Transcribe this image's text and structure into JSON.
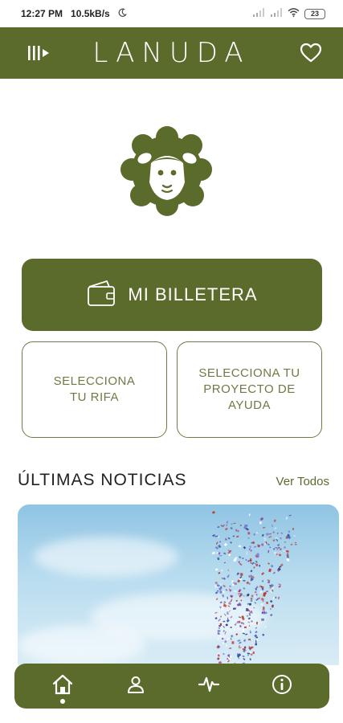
{
  "status_bar": {
    "time": "12:27 PM",
    "network_speed": "10.5kB/s",
    "battery": "23"
  },
  "header": {
    "brand": "LANUDA",
    "left_icon": "music-playlist-icon",
    "right_icon": "heart-icon"
  },
  "mascot": {
    "icon": "sheep-logo-icon"
  },
  "wallet": {
    "label": "MI BILLETERA",
    "icon": "wallet-icon"
  },
  "options": {
    "rifa_label": "SELECCIONA\nTU RIFA",
    "proyecto_label": "SELECCIONA TU\nPROYECTO DE\nAYUDA"
  },
  "news": {
    "title": "ÚLTIMAS NOTICIAS",
    "see_all": "Ver Todos"
  },
  "bottom_nav": {
    "items": [
      "home-icon",
      "user-icon",
      "activity-icon",
      "info-icon"
    ],
    "active": "home"
  },
  "colors": {
    "brand_green": "#5b6b2c",
    "outline_green": "#6f7a44",
    "sky_blue": "#8fc4e3"
  }
}
